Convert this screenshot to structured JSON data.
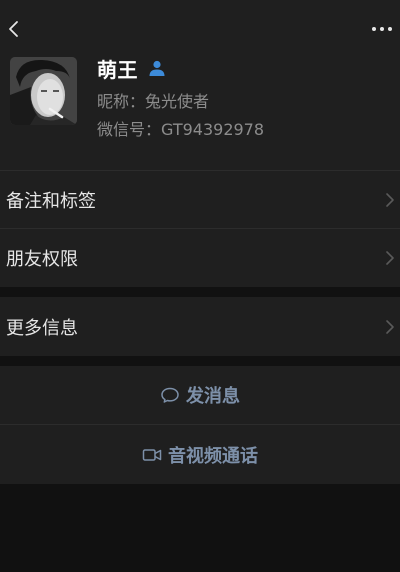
{
  "profile": {
    "name": "萌王",
    "nickname": "昵称：兔光使者",
    "wechat_id": "微信号：GT94392978"
  },
  "menu": {
    "items": [
      {
        "label": "备注和标签"
      },
      {
        "label": "朋友权限"
      },
      {
        "label": "更多信息"
      }
    ]
  },
  "actions": {
    "message": {
      "label": "发消息",
      "icon": "chat-bubble-icon"
    },
    "call": {
      "label": "音视频通话",
      "icon": "video-camera-icon"
    }
  },
  "colors": {
    "background": "#111111",
    "row": "#1f1f1f",
    "text": "#e6e6e6",
    "secondary_text": "#8c8c8c",
    "action_link": "#7d90a9",
    "badge_blue": "#3d8bd9"
  }
}
